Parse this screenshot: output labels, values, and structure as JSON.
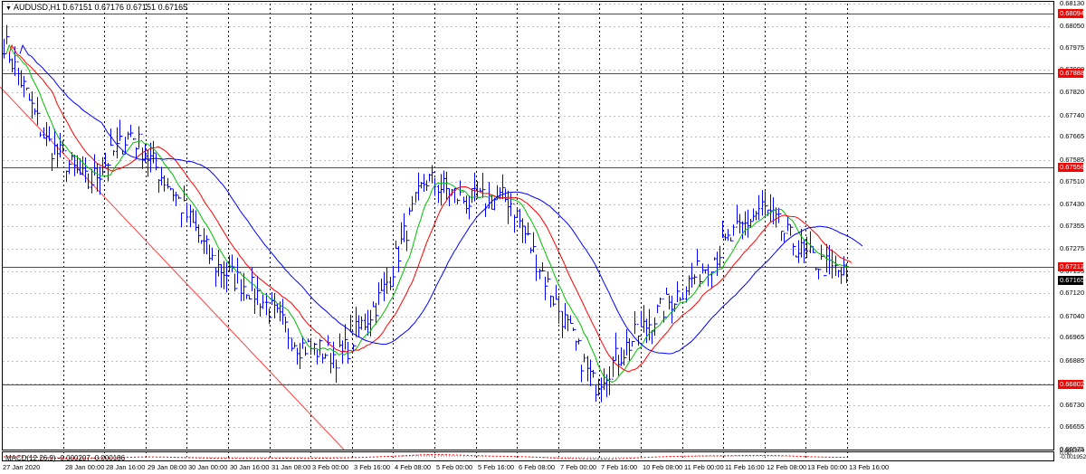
{
  "symbol_caption": "AUDUSD,H1  0.67151 0.67176 0.67151 0.67165",
  "macd_caption": "MACD(12,26,9) -0.000207 -0.000186",
  "price_ticks": [
    "0.68130",
    "0.68050",
    "0.67975",
    "0.67900",
    "0.67820",
    "0.67740",
    "0.67665",
    "0.67585",
    "0.67510",
    "0.67430",
    "0.67355",
    "0.67275",
    "0.67195",
    "0.67120",
    "0.67040",
    "0.66965",
    "0.66885",
    "0.66805",
    "0.66730",
    "0.66655",
    "0.66575"
  ],
  "horizontal_levels": [
    "0.68094",
    "0.67888",
    "0.67558",
    "0.67212",
    "0.66802"
  ],
  "current_price": "0.67165",
  "macd_ticks": [
    "0.001364",
    "0.00",
    "-0.001952"
  ],
  "time_labels": [
    "27 Jan 2020",
    "28 Jan 00:00",
    "28 Jan 16:00",
    "29 Jan 08:00",
    "30 Jan 00:00",
    "30 Jan 16:00",
    "31 Jan 08:00",
    "3 Feb 00:00",
    "3 Feb 16:00",
    "4 Feb 08:00",
    "5 Feb 00:00",
    "5 Feb 16:00",
    "6 Feb 08:00",
    "7 Feb 00:00",
    "7 Feb 16:00",
    "10 Feb 08:00",
    "11 Feb 00:00",
    "11 Feb 16:00",
    "12 Feb 08:00",
    "13 Feb 00:00",
    "13 Feb 16:00"
  ],
  "colors": {
    "bars": "#0000ff",
    "level_lines": "#ff0000",
    "ma_fast": "#00c000",
    "ma_mid": "#ff0000",
    "ma_slow": "#0000ff",
    "macd_hist": "#b0b0b0",
    "macd_signal": "#ff0000"
  },
  "chart_data": {
    "type": "line",
    "instrument": "AUDUSD",
    "timeframe": "H1",
    "ylim": [
      0.66575,
      0.6813
    ],
    "x": [
      "27 Jan 2020",
      "28 Jan 00:00",
      "28 Jan 16:00",
      "29 Jan 08:00",
      "30 Jan 00:00",
      "30 Jan 16:00",
      "31 Jan 08:00",
      "3 Feb 00:00",
      "3 Feb 16:00",
      "4 Feb 08:00",
      "5 Feb 00:00",
      "5 Feb 16:00",
      "6 Feb 08:00",
      "7 Feb 00:00",
      "7 Feb 16:00",
      "10 Feb 08:00",
      "11 Feb 00:00",
      "11 Feb 16:00",
      "12 Feb 08:00",
      "13 Feb 00:00",
      "13 Feb 16:00"
    ],
    "series": [
      {
        "values": [
          0.68,
          0.6765,
          0.675,
          0.6768,
          0.6748,
          0.6722,
          0.6712,
          0.6694,
          0.669,
          0.6712,
          0.6752,
          0.6744,
          0.6745,
          0.6712,
          0.668,
          0.6697,
          0.6712,
          0.6727,
          0.6742,
          0.6725,
          0.6718
        ]
      }
    ]
  }
}
